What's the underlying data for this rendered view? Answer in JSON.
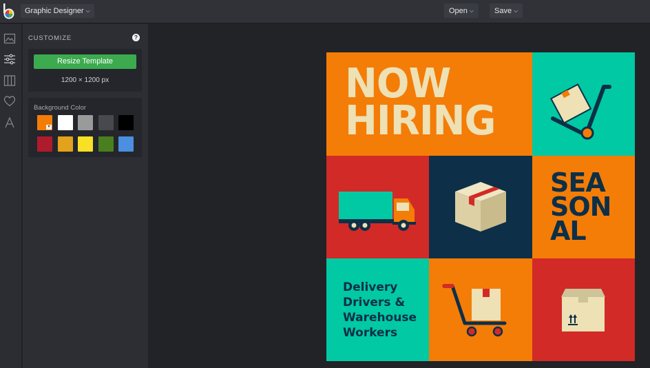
{
  "topbar": {
    "project_label": "Graphic Designer",
    "open_label": "Open",
    "save_label": "Save"
  },
  "sidebar_icons": [
    "image-icon",
    "sliders-icon",
    "columns-icon",
    "heart-icon",
    "text-icon"
  ],
  "panel": {
    "title": "CUSTOMIZE",
    "help_glyph": "?",
    "resize_button": "Resize Template",
    "size_text": "1200 × 1200 px",
    "background_label": "Background Color",
    "swatches": [
      "#f47d07",
      "#ffffff",
      "#9a9a9a",
      "#48494c",
      "#000000",
      "#b01a2d",
      "#e3a21c",
      "#f7e025",
      "#4a7f1f",
      "#4a8fe0"
    ],
    "selected_swatch": "#f47d07"
  },
  "artboard": {
    "headline_lines": [
      "NOW",
      "HIRING"
    ],
    "seasonal_lines": [
      "SEA",
      "SON",
      "AL"
    ],
    "delivery_lines": [
      "Delivery",
      "Drivers &",
      "Warehouse",
      "Workers"
    ],
    "colors": {
      "orange": "#f47d07",
      "teal": "#00c9a3",
      "red": "#d22a27",
      "navy": "#0d2f48",
      "cream": "#ede1b5"
    }
  }
}
